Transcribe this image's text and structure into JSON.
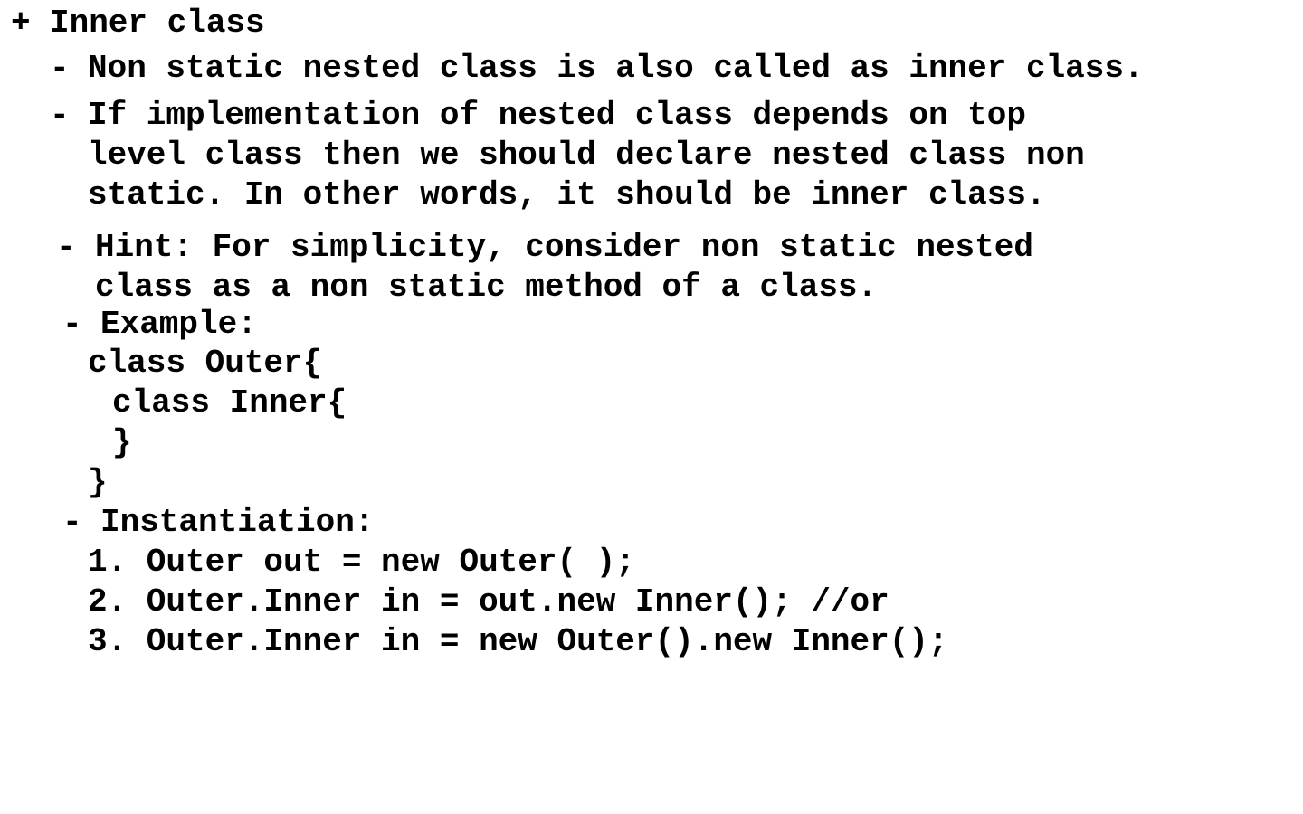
{
  "heading": {
    "bullet": "+",
    "title": "Inner class"
  },
  "points": {
    "p1": {
      "bullet": "-",
      "lines": [
        "Non static nested class is also called as inner class."
      ]
    },
    "p2": {
      "bullet": "-",
      "lines": [
        "If implementation of nested class depends on top",
        "level class then we should declare nested class non",
        "static. In other words, it should be inner class."
      ]
    },
    "p3": {
      "bullet": "-",
      "lines": [
        "Hint: For simplicity, consider non static nested",
        "class as a non static method of a class."
      ]
    },
    "p4": {
      "bullet": "-",
      "lines": [
        "Example:"
      ]
    }
  },
  "example_code": [
    "class Outer{",
    "class Inner{",
    "}",
    "}"
  ],
  "instantiation": {
    "bullet": "-",
    "label": "Instantiation:",
    "steps": [
      "1. Outer out = new Outer( );",
      "2. Outer.Inner in = out.new Inner(); //or",
      "3. Outer.Inner in = new Outer().new Inner();"
    ]
  },
  "colors": {
    "text": "#000000",
    "background": "#ffffff"
  }
}
